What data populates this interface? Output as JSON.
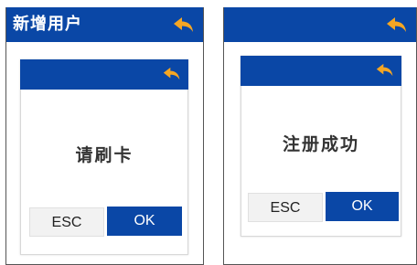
{
  "left_screen": {
    "title": "新增用户",
    "back_icon": "back-arrow-icon",
    "dialog": {
      "message": "请刷卡",
      "back_icon": "back-arrow-icon",
      "esc_label": "ESC",
      "ok_label": "OK"
    }
  },
  "right_screen": {
    "title": "",
    "back_icon": "back-arrow-icon",
    "dialog": {
      "message": "注册成功",
      "back_icon": "back-arrow-icon",
      "esc_label": "ESC",
      "ok_label": "OK"
    }
  },
  "colors": {
    "header_blue": "#0a47a6",
    "arrow_orange": "#f5a623",
    "esc_button_bg": "#f2f2f2"
  }
}
